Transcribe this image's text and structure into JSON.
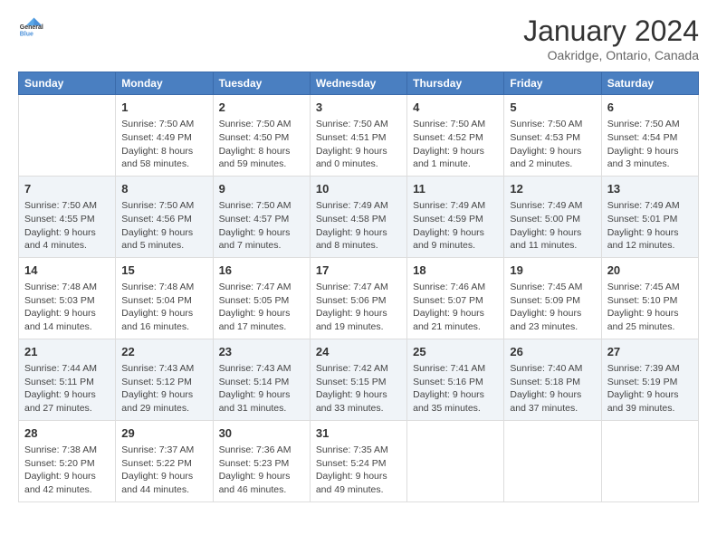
{
  "header": {
    "logo_line1": "General",
    "logo_line2": "Blue",
    "month": "January 2024",
    "location": "Oakridge, Ontario, Canada"
  },
  "days_of_week": [
    "Sunday",
    "Monday",
    "Tuesday",
    "Wednesday",
    "Thursday",
    "Friday",
    "Saturday"
  ],
  "weeks": [
    [
      {
        "day": "",
        "content": ""
      },
      {
        "day": "1",
        "content": "Sunrise: 7:50 AM\nSunset: 4:49 PM\nDaylight: 8 hours\nand 58 minutes."
      },
      {
        "day": "2",
        "content": "Sunrise: 7:50 AM\nSunset: 4:50 PM\nDaylight: 8 hours\nand 59 minutes."
      },
      {
        "day": "3",
        "content": "Sunrise: 7:50 AM\nSunset: 4:51 PM\nDaylight: 9 hours\nand 0 minutes."
      },
      {
        "day": "4",
        "content": "Sunrise: 7:50 AM\nSunset: 4:52 PM\nDaylight: 9 hours\nand 1 minute."
      },
      {
        "day": "5",
        "content": "Sunrise: 7:50 AM\nSunset: 4:53 PM\nDaylight: 9 hours\nand 2 minutes."
      },
      {
        "day": "6",
        "content": "Sunrise: 7:50 AM\nSunset: 4:54 PM\nDaylight: 9 hours\nand 3 minutes."
      }
    ],
    [
      {
        "day": "7",
        "content": "Sunrise: 7:50 AM\nSunset: 4:55 PM\nDaylight: 9 hours\nand 4 minutes."
      },
      {
        "day": "8",
        "content": "Sunrise: 7:50 AM\nSunset: 4:56 PM\nDaylight: 9 hours\nand 5 minutes."
      },
      {
        "day": "9",
        "content": "Sunrise: 7:50 AM\nSunset: 4:57 PM\nDaylight: 9 hours\nand 7 minutes."
      },
      {
        "day": "10",
        "content": "Sunrise: 7:49 AM\nSunset: 4:58 PM\nDaylight: 9 hours\nand 8 minutes."
      },
      {
        "day": "11",
        "content": "Sunrise: 7:49 AM\nSunset: 4:59 PM\nDaylight: 9 hours\nand 9 minutes."
      },
      {
        "day": "12",
        "content": "Sunrise: 7:49 AM\nSunset: 5:00 PM\nDaylight: 9 hours\nand 11 minutes."
      },
      {
        "day": "13",
        "content": "Sunrise: 7:49 AM\nSunset: 5:01 PM\nDaylight: 9 hours\nand 12 minutes."
      }
    ],
    [
      {
        "day": "14",
        "content": "Sunrise: 7:48 AM\nSunset: 5:03 PM\nDaylight: 9 hours\nand 14 minutes."
      },
      {
        "day": "15",
        "content": "Sunrise: 7:48 AM\nSunset: 5:04 PM\nDaylight: 9 hours\nand 16 minutes."
      },
      {
        "day": "16",
        "content": "Sunrise: 7:47 AM\nSunset: 5:05 PM\nDaylight: 9 hours\nand 17 minutes."
      },
      {
        "day": "17",
        "content": "Sunrise: 7:47 AM\nSunset: 5:06 PM\nDaylight: 9 hours\nand 19 minutes."
      },
      {
        "day": "18",
        "content": "Sunrise: 7:46 AM\nSunset: 5:07 PM\nDaylight: 9 hours\nand 21 minutes."
      },
      {
        "day": "19",
        "content": "Sunrise: 7:45 AM\nSunset: 5:09 PM\nDaylight: 9 hours\nand 23 minutes."
      },
      {
        "day": "20",
        "content": "Sunrise: 7:45 AM\nSunset: 5:10 PM\nDaylight: 9 hours\nand 25 minutes."
      }
    ],
    [
      {
        "day": "21",
        "content": "Sunrise: 7:44 AM\nSunset: 5:11 PM\nDaylight: 9 hours\nand 27 minutes."
      },
      {
        "day": "22",
        "content": "Sunrise: 7:43 AM\nSunset: 5:12 PM\nDaylight: 9 hours\nand 29 minutes."
      },
      {
        "day": "23",
        "content": "Sunrise: 7:43 AM\nSunset: 5:14 PM\nDaylight: 9 hours\nand 31 minutes."
      },
      {
        "day": "24",
        "content": "Sunrise: 7:42 AM\nSunset: 5:15 PM\nDaylight: 9 hours\nand 33 minutes."
      },
      {
        "day": "25",
        "content": "Sunrise: 7:41 AM\nSunset: 5:16 PM\nDaylight: 9 hours\nand 35 minutes."
      },
      {
        "day": "26",
        "content": "Sunrise: 7:40 AM\nSunset: 5:18 PM\nDaylight: 9 hours\nand 37 minutes."
      },
      {
        "day": "27",
        "content": "Sunrise: 7:39 AM\nSunset: 5:19 PM\nDaylight: 9 hours\nand 39 minutes."
      }
    ],
    [
      {
        "day": "28",
        "content": "Sunrise: 7:38 AM\nSunset: 5:20 PM\nDaylight: 9 hours\nand 42 minutes."
      },
      {
        "day": "29",
        "content": "Sunrise: 7:37 AM\nSunset: 5:22 PM\nDaylight: 9 hours\nand 44 minutes."
      },
      {
        "day": "30",
        "content": "Sunrise: 7:36 AM\nSunset: 5:23 PM\nDaylight: 9 hours\nand 46 minutes."
      },
      {
        "day": "31",
        "content": "Sunrise: 7:35 AM\nSunset: 5:24 PM\nDaylight: 9 hours\nand 49 minutes."
      },
      {
        "day": "",
        "content": ""
      },
      {
        "day": "",
        "content": ""
      },
      {
        "day": "",
        "content": ""
      }
    ]
  ]
}
